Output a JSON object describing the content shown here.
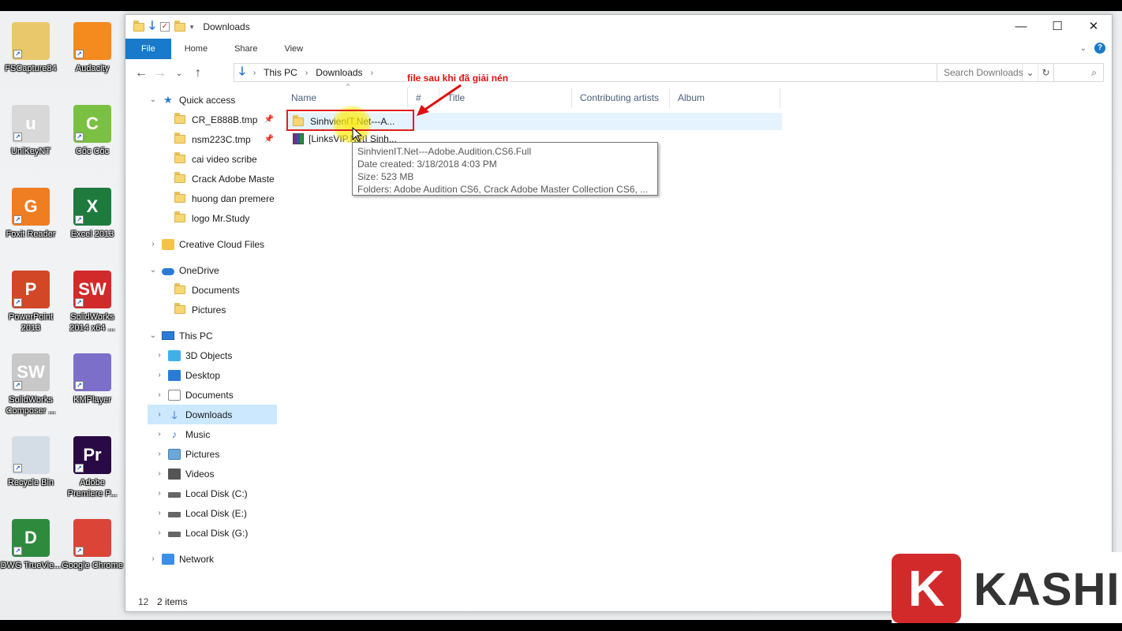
{
  "desktop_icons": [
    {
      "label": "FSCapture84",
      "color": "#e8c86a",
      "glyph": ""
    },
    {
      "label": "Audacity",
      "color": "#f58a1f",
      "glyph": ""
    },
    {
      "label": "UniKeyNT",
      "color": "#d8d8d8",
      "glyph": "u"
    },
    {
      "label": "Cốc Cốc",
      "color": "#7ac143",
      "glyph": "C"
    },
    {
      "label": "Foxit Reader",
      "color": "#ef7d22",
      "glyph": "G"
    },
    {
      "label": "Excel 2013",
      "color": "#1f7a3e",
      "glyph": "X"
    },
    {
      "label": "PowerPoint 2013",
      "color": "#d24726",
      "glyph": "P"
    },
    {
      "label": "SolidWorks 2014 x64 ...",
      "color": "#d22a2a",
      "glyph": "SW"
    },
    {
      "label": "SolidWorks Composer ...",
      "color": "#c8c8c8",
      "glyph": "SW"
    },
    {
      "label": "KMPlayer",
      "color": "#7b6fc9",
      "glyph": ""
    },
    {
      "label": "Recycle Bin",
      "color": "#d4dde6",
      "glyph": ""
    },
    {
      "label": "Adobe Premiere P...",
      "color": "#2a0a45",
      "glyph": "Pr"
    },
    {
      "label": "DWG TrueVie...",
      "color": "#2e8b3e",
      "glyph": "D"
    },
    {
      "label": "Google Chrome",
      "color": "#db4437",
      "glyph": ""
    }
  ],
  "window": {
    "title": "Downloads",
    "controls": {
      "minimize": "—",
      "maximize": "☐",
      "close": "✕"
    }
  },
  "ribbon": {
    "tabs": [
      "File",
      "Home",
      "Share",
      "View"
    ]
  },
  "address": {
    "crumbs": [
      "This PC",
      "Downloads"
    ],
    "search_placeholder": "Search Downloads"
  },
  "nav": {
    "quick_access": "Quick access",
    "quick_items": [
      {
        "label": "CR_E888B.tmp",
        "pinned": true
      },
      {
        "label": "nsm223C.tmp",
        "pinned": true
      },
      {
        "label": "cai video scribe",
        "pinned": false
      },
      {
        "label": "Crack Adobe Maste",
        "pinned": false
      },
      {
        "label": "huong dan premere",
        "pinned": false
      },
      {
        "label": "logo Mr.Study",
        "pinned": false
      }
    ],
    "creative_cloud": "Creative Cloud Files",
    "onedrive": "OneDrive",
    "onedrive_items": [
      "Documents",
      "Pictures"
    ],
    "this_pc": "This PC",
    "pc_items": [
      "3D Objects",
      "Desktop",
      "Documents",
      "Downloads",
      "Music",
      "Pictures",
      "Videos",
      "Local Disk (C:)",
      "Local Disk (E:)",
      "Local Disk (G:)"
    ],
    "network": "Network"
  },
  "columns": [
    "Name",
    "#",
    "Title",
    "Contributing artists",
    "Album"
  ],
  "files": [
    {
      "name": "SinhvienIT.Net---A...",
      "type": "folder"
    },
    {
      "name": "[LinksVIP.Net] Sinh...",
      "type": "rar"
    }
  ],
  "annotation": "file sau khi đã giải nén",
  "tooltip": {
    "name": "SinhvienIT.Net---Adobe.Audition.CS6.Full",
    "date": "Date created: 3/18/2018 4:03 PM",
    "size": "Size: 523 MB",
    "folders": "Folders: Adobe Audition CS6, Crack Adobe Master Collection CS6, ..."
  },
  "status": {
    "left_digit": "12",
    "count": "2 items"
  },
  "watermark": {
    "letter": "K",
    "text": "KASHI"
  }
}
